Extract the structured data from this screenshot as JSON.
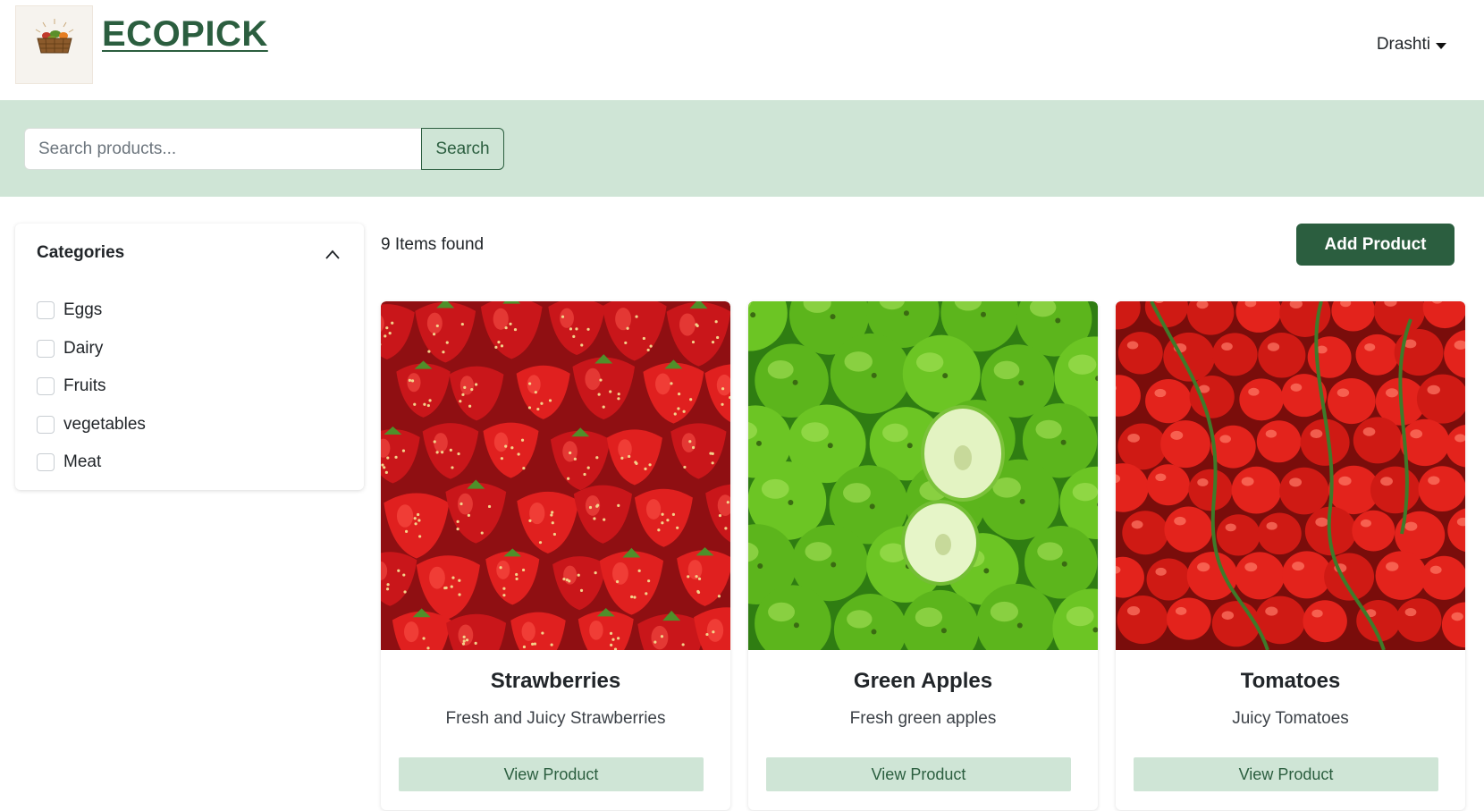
{
  "header": {
    "logo_text": "ECO PICK",
    "brand": "ECOPICK",
    "user": "Drashti"
  },
  "search": {
    "placeholder": "Search products...",
    "button_label": "Search"
  },
  "categories": {
    "title": "Categories",
    "items": [
      {
        "label": "Eggs"
      },
      {
        "label": "Dairy"
      },
      {
        "label": "Fruits"
      },
      {
        "label": "vegetables"
      },
      {
        "label": "Meat"
      }
    ]
  },
  "main": {
    "items_found": "9 Items found",
    "add_button": "Add Product"
  },
  "products": [
    {
      "title": "Strawberries",
      "description": "Fresh and Juicy Strawberries",
      "button": "View Product"
    },
    {
      "title": "Green Apples",
      "description": "Fresh green apples",
      "button": "View Product"
    },
    {
      "title": "Tomatoes",
      "description": "Juicy Tomatoes",
      "button": "View Product"
    }
  ],
  "colors": {
    "brand_green": "#2b5e3f",
    "light_green": "#cfe5d6"
  }
}
